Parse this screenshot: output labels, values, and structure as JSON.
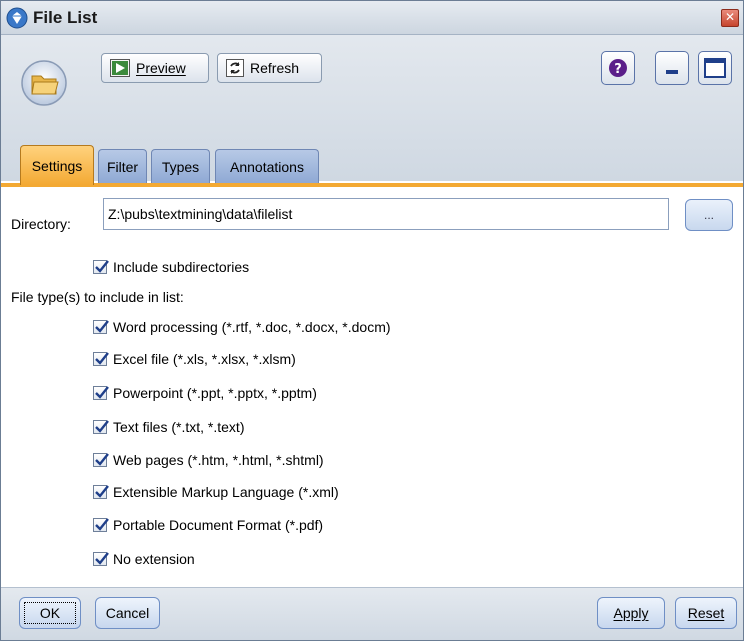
{
  "window": {
    "title": "File List"
  },
  "toolbar": {
    "preview_label": "Preview",
    "refresh_label": "Refresh"
  },
  "tabs": [
    {
      "label": "Settings",
      "active": true
    },
    {
      "label": "Filter",
      "active": false
    },
    {
      "label": "Types",
      "active": false
    },
    {
      "label": "Annotations",
      "active": false
    }
  ],
  "settings": {
    "directory_label": "Directory:",
    "directory_value": "Z:\\pubs\\textmining\\data\\filelist",
    "browse_label": "...",
    "include_subdirectories": {
      "label": "Include subdirectories",
      "checked": true
    },
    "file_types_label": "File type(s) to include in list:",
    "file_types": [
      {
        "label": "Word processing (*.rtf, *.doc, *.docx, *.docm)",
        "checked": true
      },
      {
        "label": "Excel file (*.xls, *.xlsx, *.xlsm)",
        "checked": true
      },
      {
        "label": "Powerpoint (*.ppt, *.pptx, *.pptm)",
        "checked": true
      },
      {
        "label": "Text files (*.txt, *.text)",
        "checked": true
      },
      {
        "label": "Web pages (*.htm, *.html, *.shtml)",
        "checked": true
      },
      {
        "label": "Extensible Markup Language (*.xml)",
        "checked": true
      },
      {
        "label": "Portable Document Format (*.pdf)",
        "checked": true
      },
      {
        "label": "No extension",
        "checked": true
      }
    ]
  },
  "footer": {
    "ok_label": "OK",
    "cancel_label": "Cancel",
    "apply_label": "Apply",
    "reset_label": "Reset"
  },
  "colors": {
    "active_tab": "#f3a933",
    "inactive_tab": "#8fa9d4",
    "header_bg": "#d6dee7"
  }
}
